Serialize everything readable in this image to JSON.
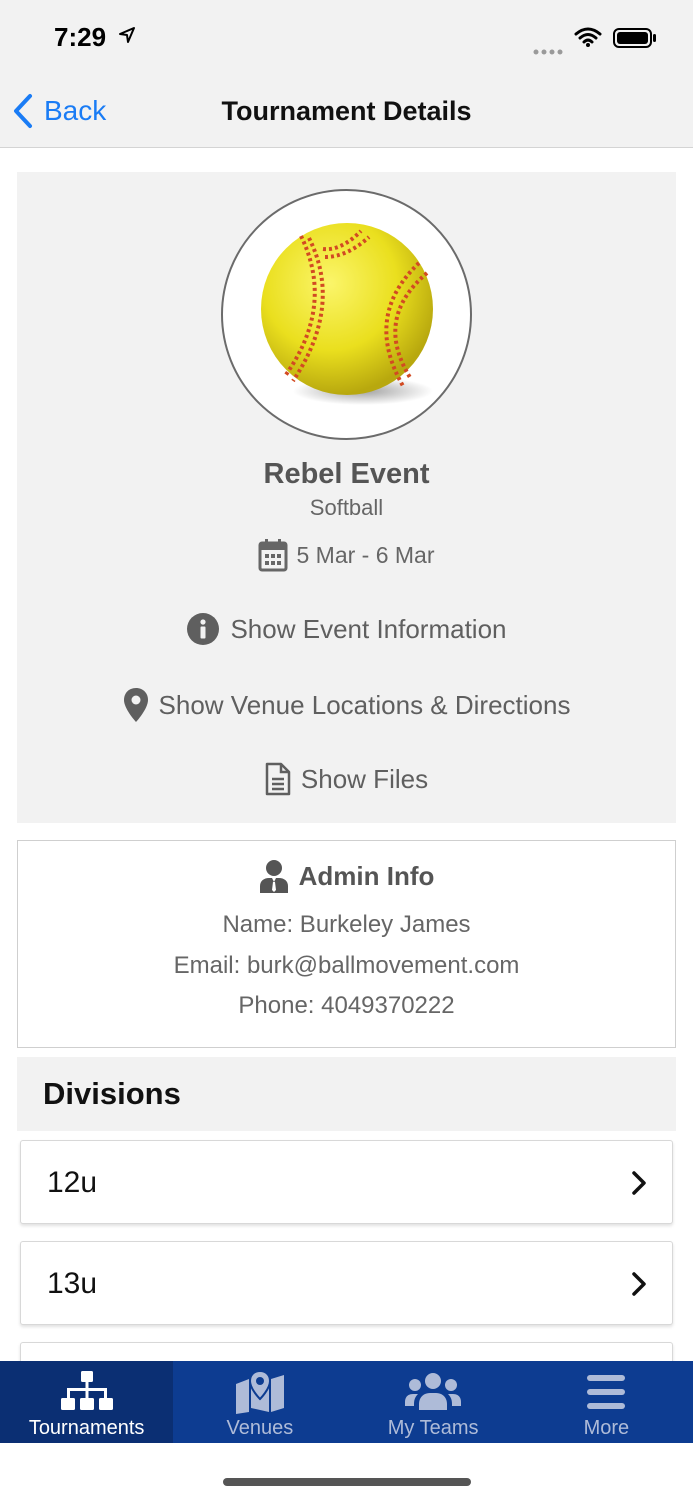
{
  "status_bar": {
    "time": "7:29"
  },
  "nav": {
    "back_label": "Back",
    "title": "Tournament Details"
  },
  "event": {
    "name": "Rebel Event",
    "sport": "Softball",
    "dates": "5 Mar - 6 Mar",
    "actions": [
      {
        "label": "Show Event Information",
        "icon": "info-icon"
      },
      {
        "label": "Show Venue Locations & Directions",
        "icon": "map-pin-icon"
      },
      {
        "label": "Show Files",
        "icon": "file-icon"
      }
    ]
  },
  "admin": {
    "title": "Admin Info",
    "name_line": "Name: Burkeley James",
    "email_line": "Email: burk@ballmovement.com",
    "phone_line": "Phone: 4049370222"
  },
  "divisions": {
    "title": "Divisions",
    "items": [
      {
        "label": "12u"
      },
      {
        "label": "13u"
      },
      {
        "label": ""
      }
    ]
  },
  "tabbar": {
    "active": "Tournaments",
    "tabs": [
      {
        "label": "Tournaments",
        "icon": "sitemap-icon"
      },
      {
        "label": "Venues",
        "icon": "map-icon"
      },
      {
        "label": "My Teams",
        "icon": "users-icon"
      },
      {
        "label": "More",
        "icon": "menu-icon"
      }
    ]
  },
  "colors": {
    "accent": "#1a7cf5",
    "tabbar": "#0d3c91",
    "tab_active": "#0b2f73",
    "softball_yellow": "#f2e623",
    "softball_stitch": "#d24a22"
  }
}
